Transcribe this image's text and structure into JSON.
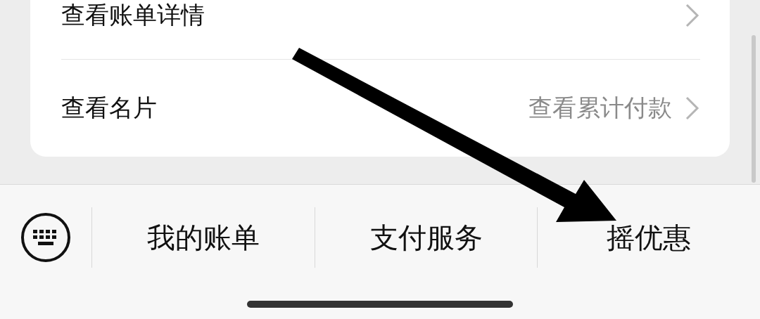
{
  "card": {
    "rows": [
      {
        "label": "查看账单详情"
      },
      {
        "label": "查看名片",
        "value": "查看累计付款"
      }
    ]
  },
  "bottom_menu": {
    "items": [
      {
        "label": "我的账单"
      },
      {
        "label": "支付服务"
      },
      {
        "label": "摇优惠"
      }
    ]
  }
}
